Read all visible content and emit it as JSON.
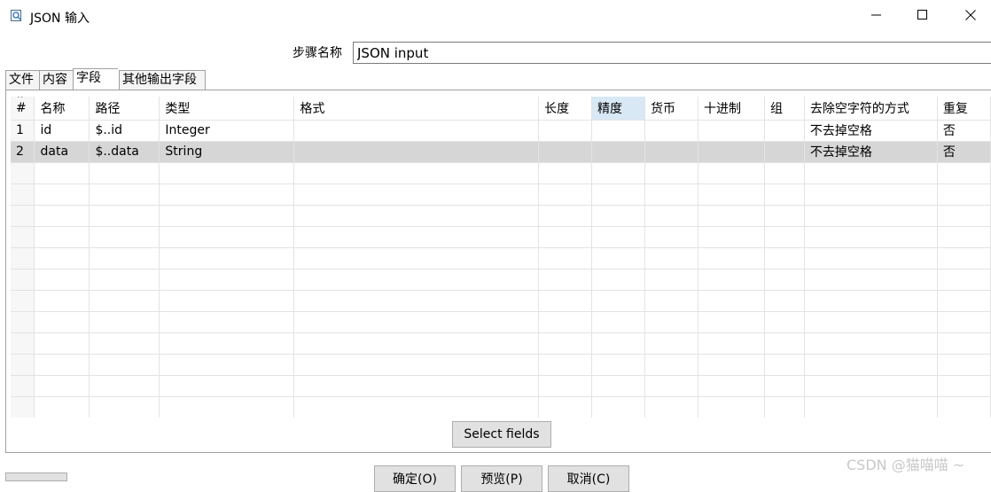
{
  "window": {
    "title": "JSON 输入",
    "icon": "json-input-step-icon"
  },
  "step": {
    "label": "步骤名称",
    "value": "JSON input"
  },
  "tabs": [
    {
      "label": "文件",
      "active": false
    },
    {
      "label": "内容",
      "active": false
    },
    {
      "label": "字段",
      "active": true
    },
    {
      "label": "其他输出字段",
      "active": false
    }
  ],
  "table": {
    "columns": [
      "#",
      "名称",
      "路径",
      "类型",
      "格式",
      "长度",
      "精度",
      "货币",
      "十进制",
      "组",
      "去除空字符的方式",
      "重复"
    ],
    "sorted_column": "精度",
    "rows": [
      {
        "num": "1",
        "name": "id",
        "path": "$..id",
        "type": "Integer",
        "format": "",
        "length": "",
        "precision": "",
        "currency": "",
        "decimal": "",
        "group": "",
        "trim": "不去掉空格",
        "repeat": "否",
        "selected": false
      },
      {
        "num": "2",
        "name": "data",
        "path": "$..data",
        "type": "String",
        "format": "",
        "length": "",
        "precision": "",
        "currency": "",
        "decimal": "",
        "group": "",
        "trim": "不去掉空格",
        "repeat": "否",
        "selected": true
      }
    ]
  },
  "buttons": {
    "select_fields": "Select fields",
    "ok": "确定(O)",
    "preview": "预览(P)",
    "cancel": "取消(C)"
  },
  "watermark": "CSDN @猫喵喵 ~"
}
